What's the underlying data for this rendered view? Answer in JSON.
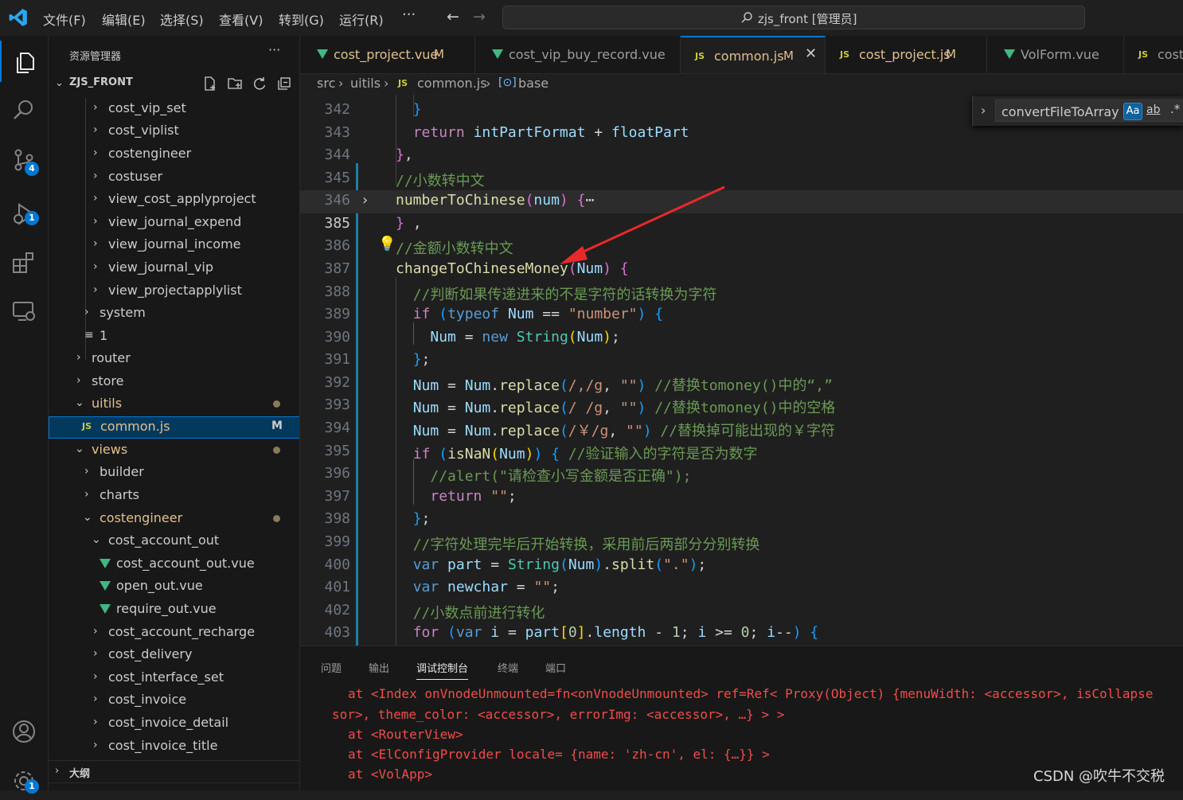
{
  "titlebar": {
    "menus": [
      "文件(F)",
      "编辑(E)",
      "选择(S)",
      "查看(V)",
      "转到(G)",
      "运行(R)"
    ],
    "more": "···",
    "back": "←",
    "forward": "→",
    "command_center": "zjs_front [管理员]"
  },
  "activity": {
    "scm_badge": "4",
    "debug_badge": "1",
    "settings_badge": "1"
  },
  "sidebar": {
    "title": "资源管理器",
    "more": "···",
    "project": "ZJS_FRONT",
    "items": [
      {
        "label": "cost_vip_set",
        "type": "folder"
      },
      {
        "label": "cost_viplist",
        "type": "folder"
      },
      {
        "label": "costengineer",
        "type": "folder"
      },
      {
        "label": "costuser",
        "type": "folder"
      },
      {
        "label": "view_cost_applyproject",
        "type": "folder"
      },
      {
        "label": "view_journal_expend",
        "type": "folder"
      },
      {
        "label": "view_journal_income",
        "type": "folder"
      },
      {
        "label": "view_journal_vip",
        "type": "folder"
      },
      {
        "label": "view_projectapplylist",
        "type": "folder"
      },
      {
        "label": "system",
        "type": "folder"
      },
      {
        "label": "1",
        "type": "file"
      },
      {
        "label": "router",
        "type": "folder"
      },
      {
        "label": "store",
        "type": "folder"
      },
      {
        "label": "uitils",
        "type": "folder-open"
      },
      {
        "label": "common.js",
        "type": "js",
        "status": "M"
      },
      {
        "label": "views",
        "type": "folder-open"
      },
      {
        "label": "builder",
        "type": "folder"
      },
      {
        "label": "charts",
        "type": "folder"
      },
      {
        "label": "costengineer",
        "type": "folder-open"
      },
      {
        "label": "cost_account_out",
        "type": "folder-open"
      },
      {
        "label": "cost_account_out.vue",
        "type": "vue"
      },
      {
        "label": "open_out.vue",
        "type": "vue"
      },
      {
        "label": "require_out.vue",
        "type": "vue"
      },
      {
        "label": "cost_account_recharge",
        "type": "folder"
      },
      {
        "label": "cost_delivery",
        "type": "folder"
      },
      {
        "label": "cost_interface_set",
        "type": "folder"
      },
      {
        "label": "cost_invoice",
        "type": "folder"
      },
      {
        "label": "cost_invoice_detail",
        "type": "folder"
      },
      {
        "label": "cost_invoice_title",
        "type": "folder"
      }
    ],
    "outline": "大纲"
  },
  "tabs": [
    {
      "label": "cost_project.vue",
      "type": "vue",
      "status": "M"
    },
    {
      "label": "cost_vip_buy_record.vue",
      "type": "vue",
      "status": ""
    },
    {
      "label": "common.js",
      "type": "js",
      "status": "M"
    },
    {
      "label": "cost_project.js",
      "type": "js",
      "status": "M"
    },
    {
      "label": "VolForm.vue",
      "type": "vue",
      "status": ""
    },
    {
      "label": "cost",
      "type": "js",
      "status": ""
    }
  ],
  "breadcrumb": {
    "parts": [
      "src",
      "uitils",
      "common.js",
      "base"
    ],
    "js_badge": "JS"
  },
  "find": {
    "query": "convertFileToArray",
    "case_label": "Aa",
    "word_label": "ab",
    "regex_label": ".*"
  },
  "editor": {
    "line_numbers": [
      "342",
      "343",
      "344",
      "345",
      "346",
      "385",
      "386",
      "387",
      "388",
      "389",
      "390",
      "391",
      "392",
      "393",
      "394",
      "395",
      "396",
      "397",
      "398",
      "399",
      "400",
      "401",
      "402",
      "403"
    ]
  },
  "panel": {
    "tabs": [
      "问题",
      "输出",
      "调试控制台",
      "终端",
      "端口"
    ],
    "output": [
      "at <Index onVnodeUnmounted=fn<onVnodeUnmounted> ref=Ref< Proxy(Object) {menuWidth: <accessor>, isCollapse",
      "sor>, theme_color: <accessor>, errorImg: <accessor>, …} > >",
      "at <RouterView>",
      "at <ElConfigProvider locale= {name: 'zh-cn', el: {…}} >",
      "at <VolApp>"
    ]
  },
  "watermark": "CSDN @吹牛不交税",
  "colors": {
    "accent": "#0078d4",
    "vue": "#41b883",
    "js": "#cbcb41",
    "error": "#f14c4c"
  }
}
